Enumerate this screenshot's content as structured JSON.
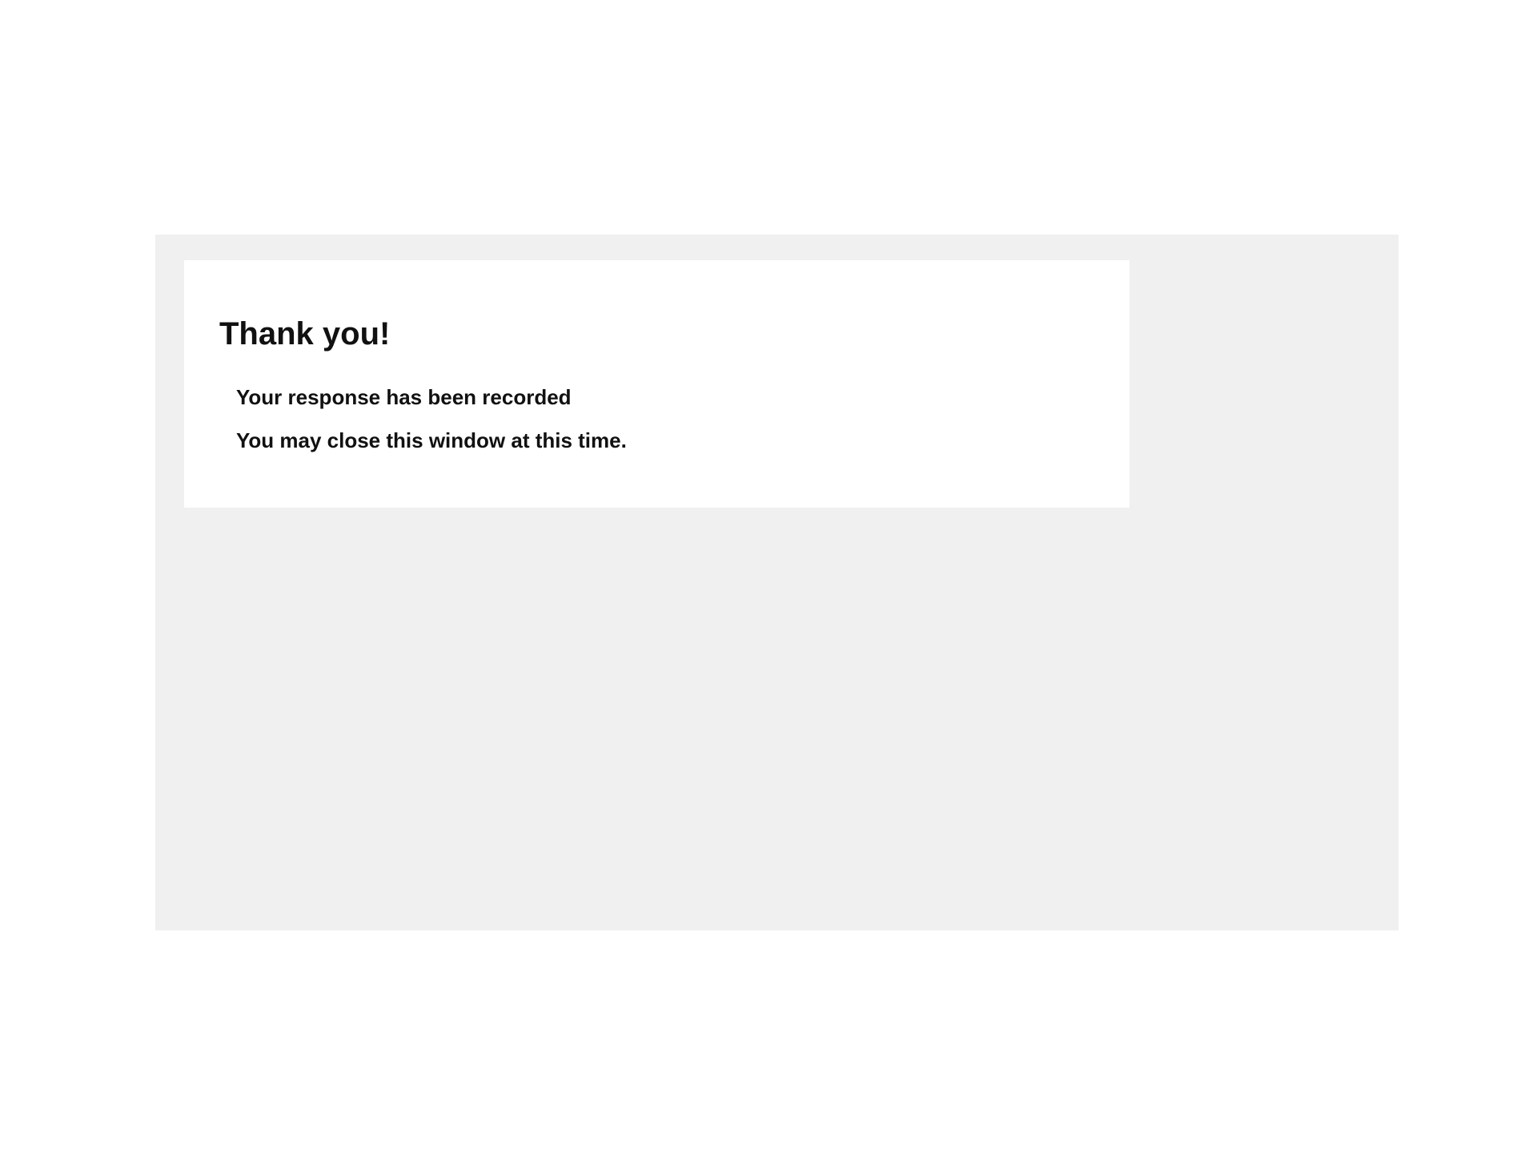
{
  "confirmation": {
    "title": "Thank you!",
    "message_recorded": "Your response has been recorded",
    "message_close": "You may close this window at this time."
  },
  "colors": {
    "page_background": "#ffffff",
    "content_background": "#f0f0f0",
    "card_background": "#ffffff",
    "text": "#111111"
  }
}
